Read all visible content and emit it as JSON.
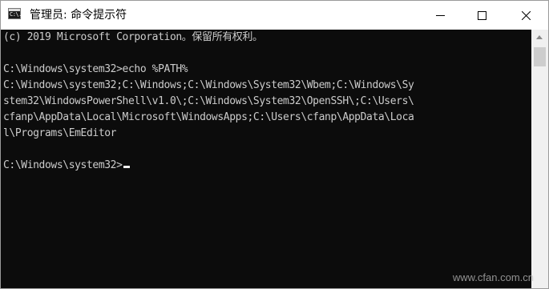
{
  "window": {
    "title": "管理员: 命令提示符",
    "icon_label": "C:\\.",
    "icons": {
      "app": "cmd-icon",
      "minimize": "minimize-icon",
      "maximize": "maximize-icon",
      "close": "close-icon"
    }
  },
  "console": {
    "lines": [
      "(c) 2019 Microsoft Corporation。保留所有权利。",
      "",
      "C:\\Windows\\system32>echo %PATH%",
      "C:\\Windows\\system32;C:\\Windows;C:\\Windows\\System32\\Wbem;C:\\Windows\\Sy",
      "stem32\\WindowsPowerShell\\v1.0\\;C:\\Windows\\System32\\OpenSSH\\;C:\\Users\\",
      "cfanp\\AppData\\Local\\Microsoft\\WindowsApps;C:\\Users\\cfanp\\AppData\\Loca",
      "l\\Programs\\EmEditor",
      "",
      "C:\\Windows\\system32>"
    ],
    "text_color": "#cccccc",
    "background": "#0c0c0c"
  },
  "watermark": "www.cfan.com.cn"
}
